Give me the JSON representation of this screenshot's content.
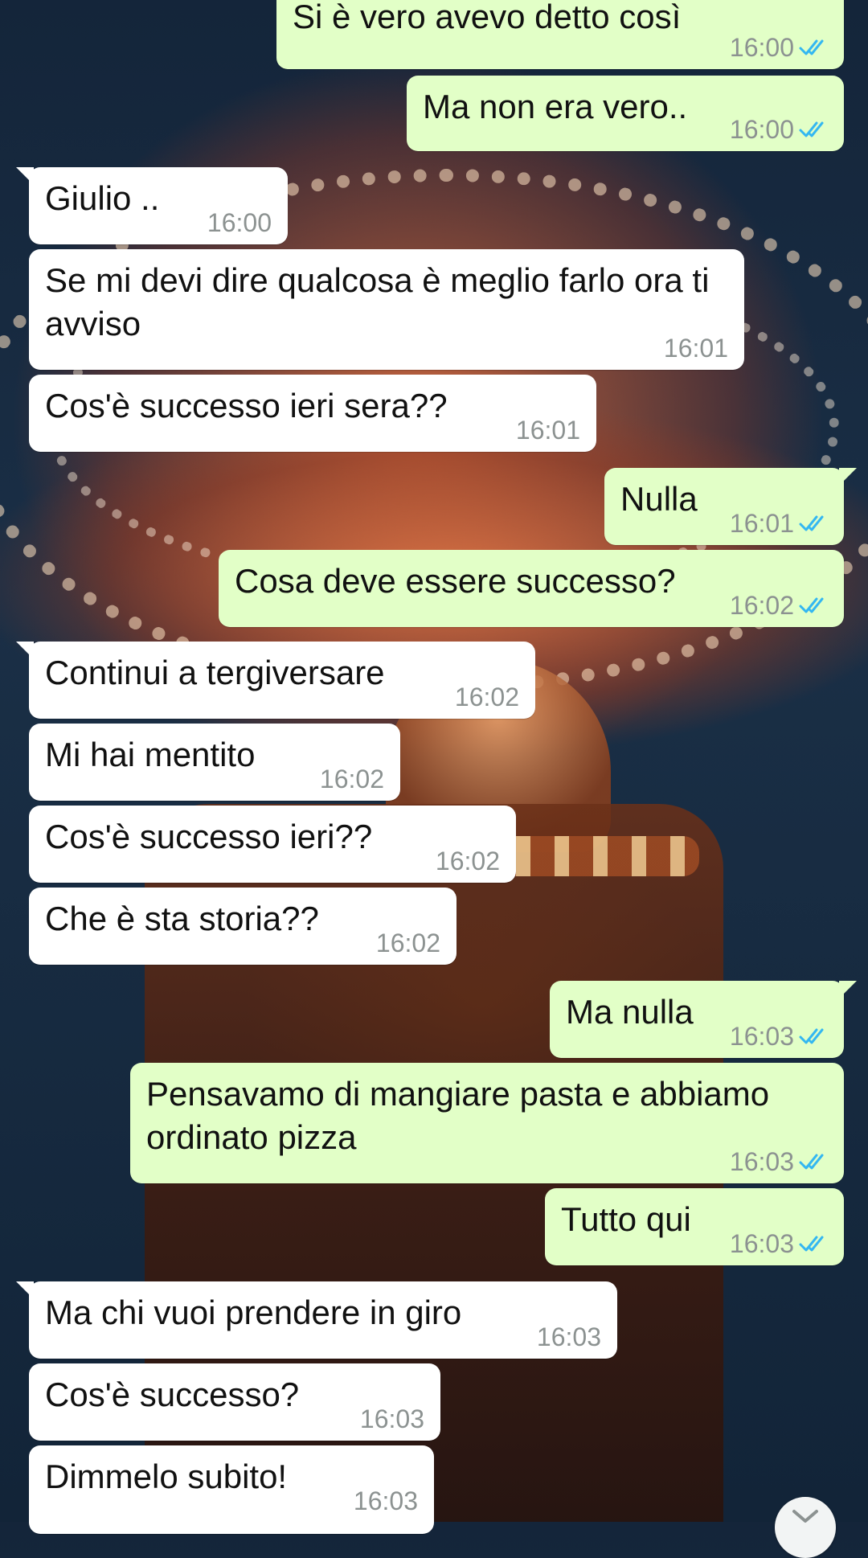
{
  "colors": {
    "incoming_bubble": "#ffffff",
    "outgoing_bubble": "#e2ffc7",
    "timestamp": "#8c9291",
    "read_ticks": "#34b7f1"
  },
  "wallpaper": "carousel-night-photo",
  "messages": [
    {
      "dir": "out",
      "text": "Si è vero avevo detto così",
      "time": "16:00",
      "status": "read"
    },
    {
      "dir": "out",
      "text": "Ma non era vero..",
      "time": "16:00",
      "status": "read"
    },
    {
      "dir": "in",
      "text": "Giulio ..",
      "time": "16:00"
    },
    {
      "dir": "in",
      "text": "Se mi devi dire qualcosa è meglio farlo ora ti avviso",
      "time": "16:01"
    },
    {
      "dir": "in",
      "text": "Cos'è successo ieri sera??",
      "time": "16:01"
    },
    {
      "dir": "out",
      "text": "Nulla",
      "time": "16:01",
      "status": "read"
    },
    {
      "dir": "out",
      "text": "Cosa deve essere successo?",
      "time": "16:02",
      "status": "read"
    },
    {
      "dir": "in",
      "text": "Continui a tergiversare",
      "time": "16:02"
    },
    {
      "dir": "in",
      "text": "Mi hai mentito",
      "time": "16:02"
    },
    {
      "dir": "in",
      "text": "Cos'è successo ieri??",
      "time": "16:02"
    },
    {
      "dir": "in",
      "text": "Che è sta storia??",
      "time": "16:02"
    },
    {
      "dir": "out",
      "text": "Ma nulla",
      "time": "16:03",
      "status": "read"
    },
    {
      "dir": "out",
      "text": "Pensavamo di mangiare pasta e abbiamo ordinato pizza",
      "time": "16:03",
      "status": "read"
    },
    {
      "dir": "out",
      "text": "Tutto qui",
      "time": "16:03",
      "status": "read"
    },
    {
      "dir": "in",
      "text": "Ma chi vuoi prendere in giro",
      "time": "16:03"
    },
    {
      "dir": "in",
      "text": "Cos'è successo?",
      "time": "16:03"
    },
    {
      "dir": "in",
      "text": "Dimmelo subito!",
      "time": "16:03"
    }
  ]
}
